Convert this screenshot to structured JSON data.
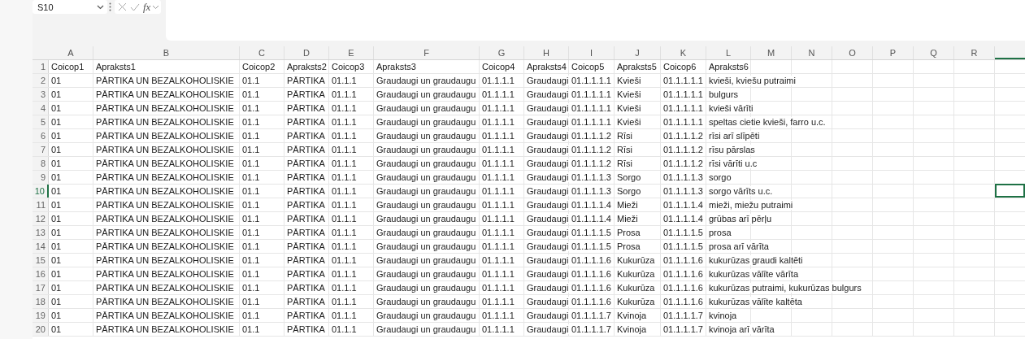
{
  "formula_bar": {
    "name_box": "S10",
    "function_label": "fx"
  },
  "columns": [
    "A",
    "B",
    "C",
    "D",
    "E",
    "F",
    "G",
    "H",
    "I",
    "J",
    "K",
    "L",
    "M",
    "N",
    "O",
    "P",
    "Q",
    "R"
  ],
  "rows": [
    {
      "number": "1",
      "selected": false,
      "cells": [
        "Coicop1",
        "Apraksts1",
        "Coicop2",
        "Apraksts2",
        "Coicop3",
        "Apraksts3",
        "Coicop4",
        "Apraksts4",
        "Coicop5",
        "Apraksts5",
        "Coicop6",
        "Apraksts6"
      ]
    },
    {
      "number": "2",
      "selected": false,
      "cells": [
        "01",
        "PĀRTIKA UN BEZALKOHOLISKIE",
        "01.1",
        "PĀRTIKA",
        "01.1.1",
        "Graudaugi un graudaugu",
        "01.1.1.1",
        "Graudaugi",
        "01.1.1.1.1",
        "Kvieši",
        "01.1.1.1.1",
        "kvieši, kviešu putraimi"
      ]
    },
    {
      "number": "3",
      "selected": false,
      "cells": [
        "01",
        "PĀRTIKA UN BEZALKOHOLISKIE",
        "01.1",
        "PĀRTIKA",
        "01.1.1",
        "Graudaugi un graudaugu",
        "01.1.1.1",
        "Graudaugi",
        "01.1.1.1.1",
        "Kvieši",
        "01.1.1.1.1",
        "bulgurs"
      ]
    },
    {
      "number": "4",
      "selected": false,
      "cells": [
        "01",
        "PĀRTIKA UN BEZALKOHOLISKIE",
        "01.1",
        "PĀRTIKA",
        "01.1.1",
        "Graudaugi un graudaugu",
        "01.1.1.1",
        "Graudaugi",
        "01.1.1.1.1",
        "Kvieši",
        "01.1.1.1.1",
        "kvieši vārīti"
      ]
    },
    {
      "number": "5",
      "selected": false,
      "cells": [
        "01",
        "PĀRTIKA UN BEZALKOHOLISKIE",
        "01.1",
        "PĀRTIKA",
        "01.1.1",
        "Graudaugi un graudaugu",
        "01.1.1.1",
        "Graudaugi",
        "01.1.1.1.1",
        "Kvieši",
        "01.1.1.1.1",
        "speltas cietie kvieši, farro u.c."
      ]
    },
    {
      "number": "6",
      "selected": false,
      "cells": [
        "01",
        "PĀRTIKA UN BEZALKOHOLISKIE",
        "01.1",
        "PĀRTIKA",
        "01.1.1",
        "Graudaugi un graudaugu",
        "01.1.1.1",
        "Graudaugi",
        "01.1.1.1.2",
        "Rīsi",
        "01.1.1.1.2",
        "rīsi arī slīpēti"
      ]
    },
    {
      "number": "7",
      "selected": false,
      "cells": [
        "01",
        "PĀRTIKA UN BEZALKOHOLISKIE",
        "01.1",
        "PĀRTIKA",
        "01.1.1",
        "Graudaugi un graudaugu",
        "01.1.1.1",
        "Graudaugi",
        "01.1.1.1.2",
        "Rīsi",
        "01.1.1.1.2",
        "rīsu pārslas"
      ]
    },
    {
      "number": "8",
      "selected": false,
      "cells": [
        "01",
        "PĀRTIKA UN BEZALKOHOLISKIE",
        "01.1",
        "PĀRTIKA",
        "01.1.1",
        "Graudaugi un graudaugu",
        "01.1.1.1",
        "Graudaugi",
        "01.1.1.1.2",
        "Rīsi",
        "01.1.1.1.2",
        "rīsi vārīti u.c"
      ]
    },
    {
      "number": "9",
      "selected": false,
      "cells": [
        "01",
        "PĀRTIKA UN BEZALKOHOLISKIE",
        "01.1",
        "PĀRTIKA",
        "01.1.1",
        "Graudaugi un graudaugu",
        "01.1.1.1",
        "Graudaugi",
        "01.1.1.1.3",
        "Sorgo",
        "01.1.1.1.3",
        "sorgo"
      ]
    },
    {
      "number": "10",
      "selected": true,
      "cells": [
        "01",
        "PĀRTIKA UN BEZALKOHOLISKIE",
        "01.1",
        "PĀRTIKA",
        "01.1.1",
        "Graudaugi un graudaugu",
        "01.1.1.1",
        "Graudaugi",
        "01.1.1.1.3",
        "Sorgo",
        "01.1.1.1.3",
        "sorgo vārīts u.c."
      ]
    },
    {
      "number": "11",
      "selected": false,
      "cells": [
        "01",
        "PĀRTIKA UN BEZALKOHOLISKIE",
        "01.1",
        "PĀRTIKA",
        "01.1.1",
        "Graudaugi un graudaugu",
        "01.1.1.1",
        "Graudaugi",
        "01.1.1.1.4",
        "Mieži",
        "01.1.1.1.4",
        "mieži, miežu putraimi"
      ]
    },
    {
      "number": "12",
      "selected": false,
      "cells": [
        "01",
        "PĀRTIKA UN BEZALKOHOLISKIE",
        "01.1",
        "PĀRTIKA",
        "01.1.1",
        "Graudaugi un graudaugu",
        "01.1.1.1",
        "Graudaugi",
        "01.1.1.1.4",
        "Mieži",
        "01.1.1.1.4",
        "grūbas arī pērļu"
      ]
    },
    {
      "number": "13",
      "selected": false,
      "cells": [
        "01",
        "PĀRTIKA UN BEZALKOHOLISKIE",
        "01.1",
        "PĀRTIKA",
        "01.1.1",
        "Graudaugi un graudaugu",
        "01.1.1.1",
        "Graudaugi",
        "01.1.1.1.5",
        "Prosa",
        "01.1.1.1.5",
        "prosa"
      ]
    },
    {
      "number": "14",
      "selected": false,
      "cells": [
        "01",
        "PĀRTIKA UN BEZALKOHOLISKIE",
        "01.1",
        "PĀRTIKA",
        "01.1.1",
        "Graudaugi un graudaugu",
        "01.1.1.1",
        "Graudaugi",
        "01.1.1.1.5",
        "Prosa",
        "01.1.1.1.5",
        "prosa arī vārīta"
      ]
    },
    {
      "number": "15",
      "selected": false,
      "cells": [
        "01",
        "PĀRTIKA UN BEZALKOHOLISKIE",
        "01.1",
        "PĀRTIKA",
        "01.1.1",
        "Graudaugi un graudaugu",
        "01.1.1.1",
        "Graudaugi",
        "01.1.1.1.6",
        "Kukurūza",
        "01.1.1.1.6",
        "kukurūzas graudi kaltēti"
      ]
    },
    {
      "number": "16",
      "selected": false,
      "cells": [
        "01",
        "PĀRTIKA UN BEZALKOHOLISKIE",
        "01.1",
        "PĀRTIKA",
        "01.1.1",
        "Graudaugi un graudaugu",
        "01.1.1.1",
        "Graudaugi",
        "01.1.1.1.6",
        "Kukurūza",
        "01.1.1.1.6",
        "kukurūzas vālīte vārīta"
      ]
    },
    {
      "number": "17",
      "selected": false,
      "cells": [
        "01",
        "PĀRTIKA UN BEZALKOHOLISKIE",
        "01.1",
        "PĀRTIKA",
        "01.1.1",
        "Graudaugi un graudaugu",
        "01.1.1.1",
        "Graudaugi",
        "01.1.1.1.6",
        "Kukurūza",
        "01.1.1.1.6",
        "kukurūzas putraimi, kukurūzas bulgurs"
      ]
    },
    {
      "number": "18",
      "selected": false,
      "cells": [
        "01",
        "PĀRTIKA UN BEZALKOHOLISKIE",
        "01.1",
        "PĀRTIKA",
        "01.1.1",
        "Graudaugi un graudaugu",
        "01.1.1.1",
        "Graudaugi",
        "01.1.1.1.6",
        "Kukurūza",
        "01.1.1.1.6",
        "kukurūzas vālīte kaltēta"
      ]
    },
    {
      "number": "19",
      "selected": false,
      "cells": [
        "01",
        "PĀRTIKA UN BEZALKOHOLISKIE",
        "01.1",
        "PĀRTIKA",
        "01.1.1",
        "Graudaugi un graudaugu",
        "01.1.1.1",
        "Graudaugi",
        "01.1.1.1.7",
        "Kvinoja",
        "01.1.1.1.7",
        "kvinoja"
      ]
    },
    {
      "number": "20",
      "selected": false,
      "cells": [
        "01",
        "PĀRTIKA UN BEZALKOHOLISKIE",
        "01.1",
        "PĀRTIKA",
        "01.1.1",
        "Graudaugi un graudaugu",
        "01.1.1.1",
        "Graudaugi",
        "01.1.1.1.7",
        "Kvinoja",
        "01.1.1.1.7",
        "kvinoja arī vārīta"
      ]
    }
  ]
}
